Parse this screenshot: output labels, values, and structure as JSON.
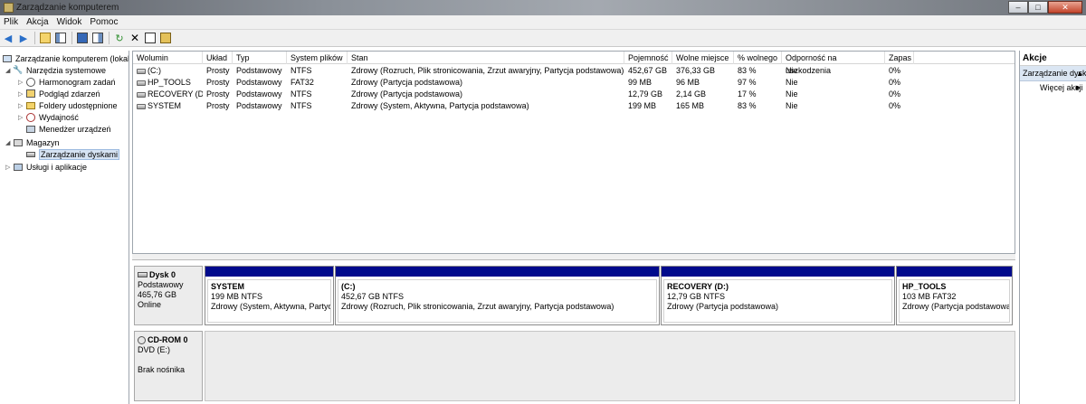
{
  "window": {
    "title": "Zarządzanie komputerem",
    "minimize": "–",
    "maximize": "□",
    "close": "✕"
  },
  "menu": [
    "Plik",
    "Akcja",
    "Widok",
    "Pomoc"
  ],
  "toolbar_icons": [
    "back-arrow-icon",
    "forward-arrow-icon",
    "up-folder-icon",
    "show-hide-tree-icon",
    "help-icon",
    "help-panel-icon",
    "refresh-icon",
    "delete-icon",
    "properties-icon",
    "export-icon"
  ],
  "tree": {
    "root": "Zarządzanie komputerem (lokalne)",
    "system_tools": "Narzędzia systemowe",
    "task_scheduler": "Harmonogram zadań",
    "event_viewer": "Podgląd zdarzeń",
    "shared_folders": "Foldery udostępnione",
    "performance": "Wydajność",
    "device_manager": "Menedżer urządzeń",
    "storage": "Magazyn",
    "disk_management": "Zarządzanie dyskami",
    "services_apps": "Usługi i aplikacje"
  },
  "volumes": {
    "columns": [
      "Wolumin",
      "Układ",
      "Typ",
      "System plików",
      "Stan",
      "Pojemność",
      "Wolne miejsce",
      "% wolnego",
      "Odporność na uszkodzenia",
      "Zapas"
    ],
    "rows": [
      {
        "name": "(C:)",
        "layout": "Prosty",
        "type": "Podstawowy",
        "fs": "NTFS",
        "status": "Zdrowy (Rozruch, Plik stronicowania, Zrzut awaryjny, Partycja podstawowa)",
        "capacity": "452,67 GB",
        "free": "376,33 GB",
        "pct": "83 %",
        "fault": "Nie",
        "overhead": "0%"
      },
      {
        "name": "HP_TOOLS",
        "layout": "Prosty",
        "type": "Podstawowy",
        "fs": "FAT32",
        "status": "Zdrowy (Partycja podstawowa)",
        "capacity": "99 MB",
        "free": "96 MB",
        "pct": "97 %",
        "fault": "Nie",
        "overhead": "0%"
      },
      {
        "name": "RECOVERY (D:)",
        "layout": "Prosty",
        "type": "Podstawowy",
        "fs": "NTFS",
        "status": "Zdrowy (Partycja podstawowa)",
        "capacity": "12,79 GB",
        "free": "2,14 GB",
        "pct": "17 %",
        "fault": "Nie",
        "overhead": "0%"
      },
      {
        "name": "SYSTEM",
        "layout": "Prosty",
        "type": "Podstawowy",
        "fs": "NTFS",
        "status": "Zdrowy (System, Aktywna, Partycja podstawowa)",
        "capacity": "199 MB",
        "free": "165 MB",
        "pct": "83 %",
        "fault": "Nie",
        "overhead": "0%"
      }
    ]
  },
  "disk0": {
    "name": "Dysk 0",
    "type": "Podstawowy",
    "size": "465,76 GB",
    "state": "Online",
    "partitions": [
      {
        "name": "SYSTEM",
        "size": "199 MB NTFS",
        "status": "Zdrowy (System, Aktywna, Partycja podstawowa)"
      },
      {
        "name": "(C:)",
        "size": "452,67 GB NTFS",
        "status": "Zdrowy (Rozruch, Plik stronicowania, Zrzut awaryjny, Partycja podstawowa)"
      },
      {
        "name": "RECOVERY  (D:)",
        "size": "12,79 GB NTFS",
        "status": "Zdrowy (Partycja podstawowa)"
      },
      {
        "name": "HP_TOOLS",
        "size": "103 MB FAT32",
        "status": "Zdrowy (Partycja podstawowa)"
      }
    ]
  },
  "cdrom": {
    "name": "CD-ROM 0",
    "drive": "DVD (E:)",
    "media": "Brak nośnika"
  },
  "actions": {
    "header": "Akcje",
    "section": "Zarządzanie dyskami",
    "more": "Więcej akcji",
    "arrow_up": "▲",
    "arrow_right": "▶"
  },
  "colors": {
    "partition_bar": "#000a8c",
    "selection": "#d6e3f3"
  }
}
